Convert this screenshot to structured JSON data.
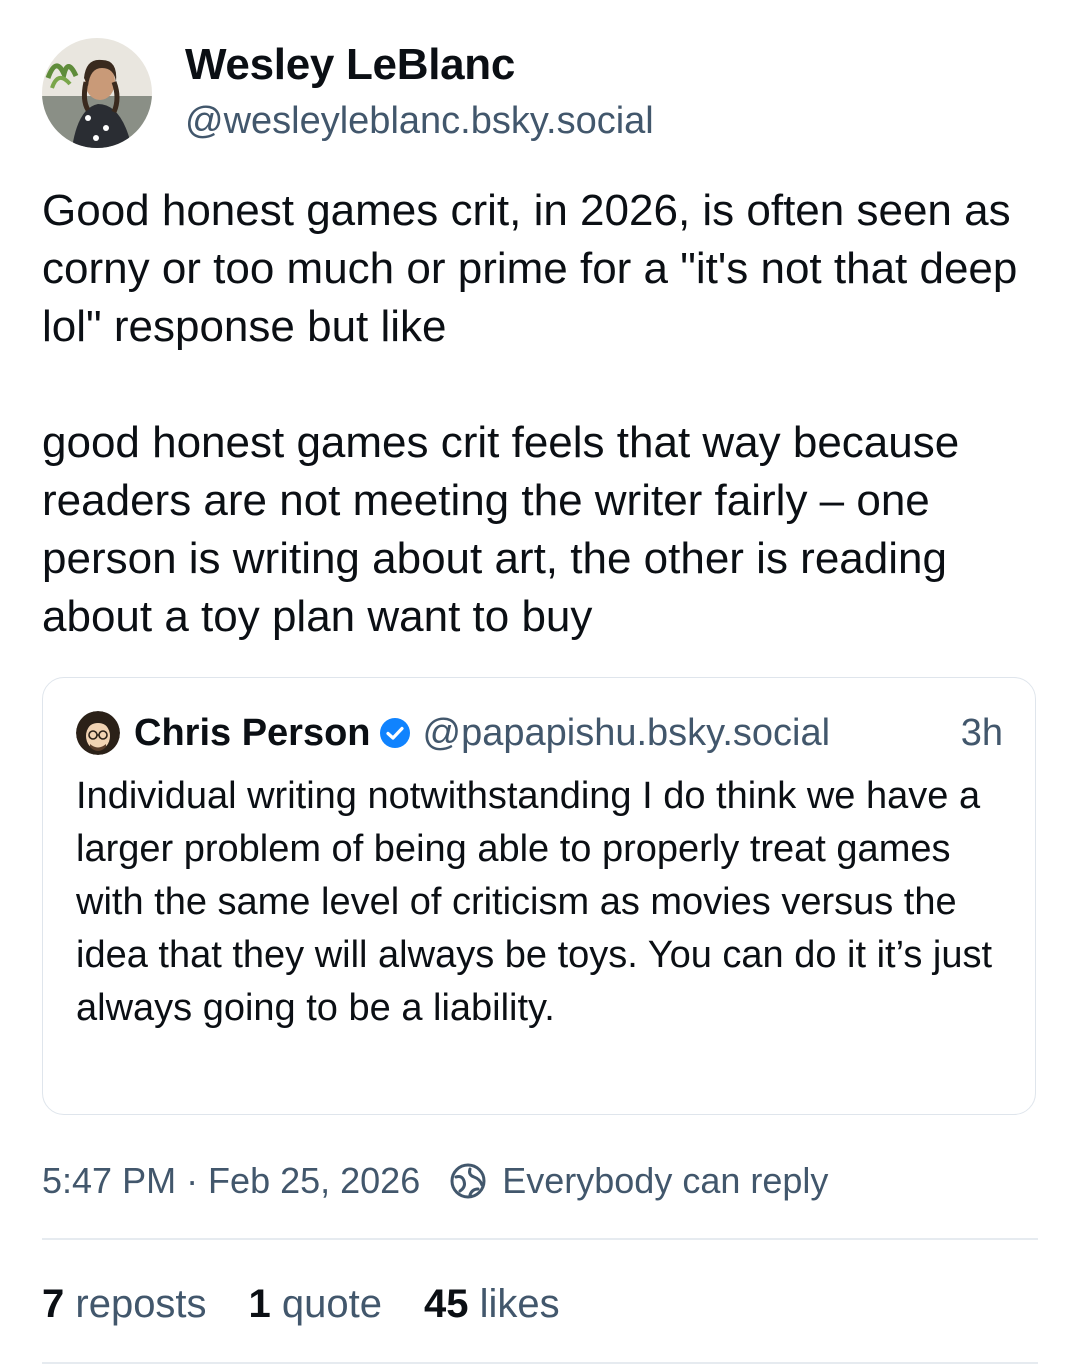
{
  "author": {
    "display_name": "Wesley LeBlanc",
    "handle": "@wesleyleblanc.bsky.social"
  },
  "post": {
    "text": "Good honest games crit, in 2026, is often seen as corny or too much or prime for a \"it's not that deep lol\" response but like\n\ngood honest games crit feels that way because readers are not meeting the writer fairly – one person is writing about art, the other is reading about a toy plan want to buy"
  },
  "quote": {
    "display_name": "Chris Person",
    "verified_icon": "verified-check-icon",
    "handle": "@papapishu.bsky.social",
    "time": "3h",
    "text": "Individual writing notwithstanding I do think we have a larger problem of being able to properly treat games with the same level of criticism as movies versus the idea that they will always be toys. You can do it it’s just always going to be a liability."
  },
  "meta": {
    "timestamp": "5:47 PM · Feb 25, 2026",
    "reply_setting": "Everybody can reply",
    "reply_icon": "globe-icon"
  },
  "stats": {
    "reposts_count": "7",
    "reposts_label": "reposts",
    "quotes_count": "1",
    "quotes_label": "quote",
    "likes_count": "45",
    "likes_label": "likes"
  },
  "colors": {
    "text": "#0b0f14",
    "muted": "#42576c",
    "border": "#dfe5ec",
    "verified": "#1083fe"
  }
}
